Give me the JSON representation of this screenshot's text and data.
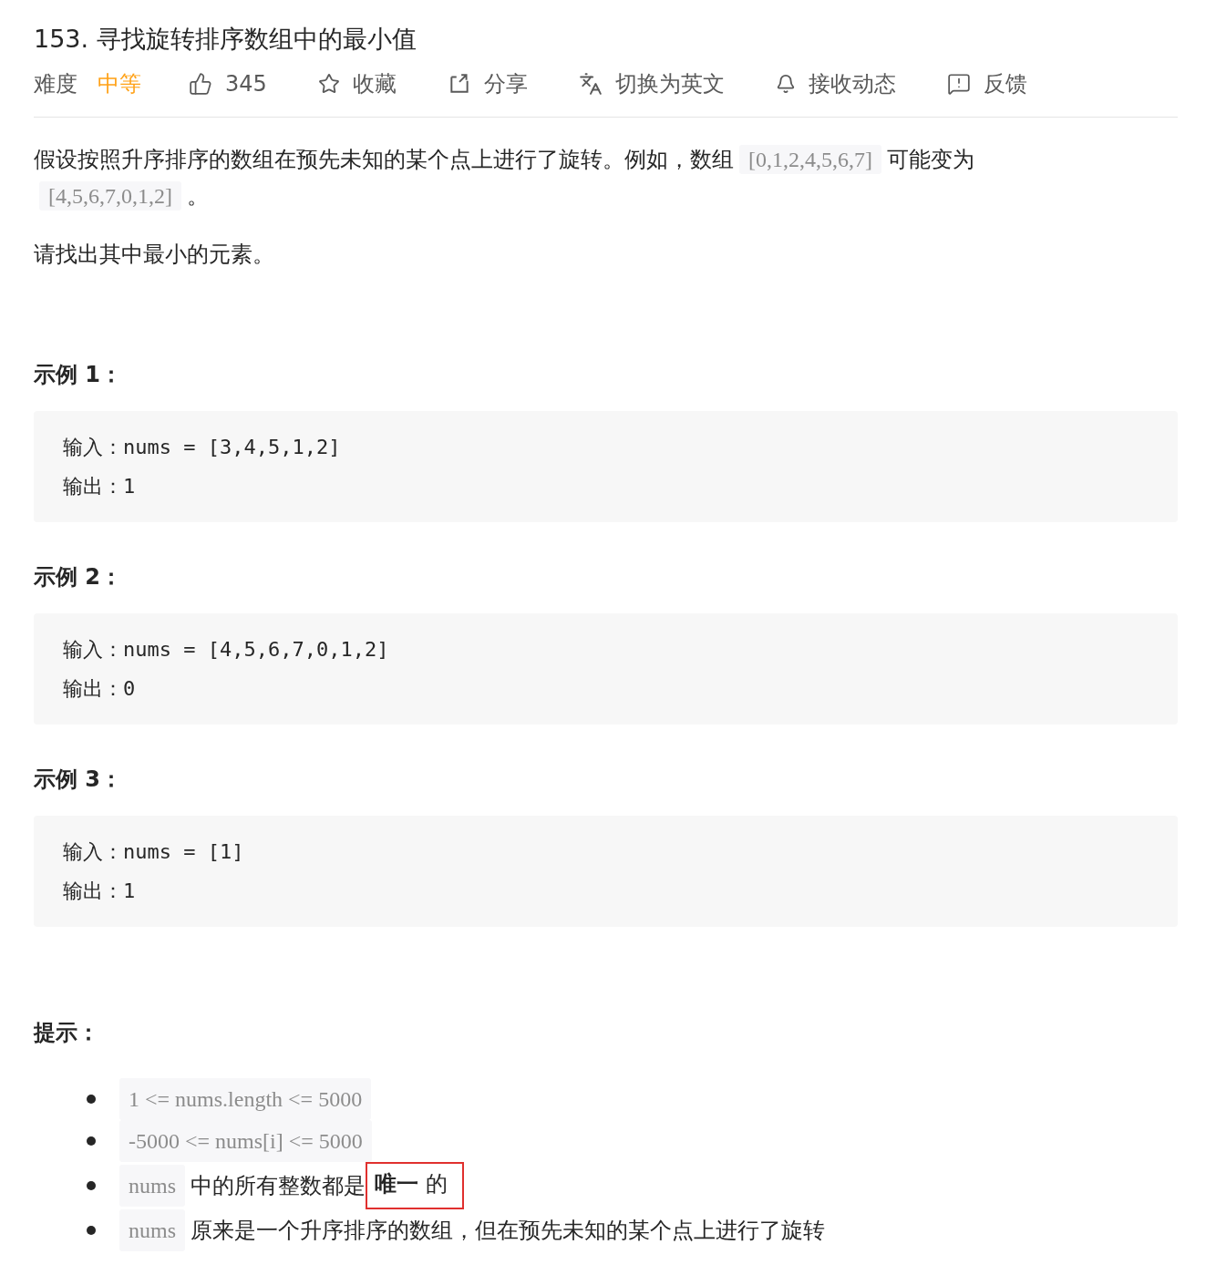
{
  "title": "153. 寻找旋转排序数组中的最小值",
  "meta": {
    "difficulty_label": "难度",
    "difficulty": "中等"
  },
  "actions": [
    {
      "kind": "like",
      "label": "345"
    },
    {
      "kind": "star",
      "label": "收藏"
    },
    {
      "kind": "share",
      "label": "分享"
    },
    {
      "kind": "translate",
      "label": "切换为英文"
    },
    {
      "kind": "bell",
      "label": "接收动态"
    },
    {
      "kind": "feedback",
      "label": "反馈"
    }
  ],
  "description": [
    [
      {
        "kind": "text",
        "text": "假设按照升序排序的数组在预先未知的某个点上进行了旋转。例如，数组"
      },
      {
        "kind": "code",
        "text": "[0,1,2,4,5,6,7]"
      },
      {
        "kind": "text",
        "text": "可能变为"
      },
      {
        "kind": "code",
        "text": "[4,5,6,7,0,1,2]"
      },
      {
        "kind": "text",
        "text": "。"
      }
    ],
    [
      {
        "kind": "text",
        "text": "请找出其中最小的元素。"
      }
    ]
  ],
  "examples": [
    {
      "heading": "示例 1：",
      "lines": [
        "输入：nums = [3,4,5,1,2]",
        "输出：1"
      ]
    },
    {
      "heading": "示例 2：",
      "lines": [
        "输入：nums = [4,5,6,7,0,1,2]",
        "输出：0"
      ]
    },
    {
      "heading": "示例 3：",
      "lines": [
        "输入：nums = [1]",
        "输出：1"
      ]
    }
  ],
  "hints": {
    "heading": "提示：",
    "items": [
      [
        {
          "kind": "code",
          "text": "1 <= nums.length <= 5000"
        }
      ],
      [
        {
          "kind": "code",
          "text": "-5000 <= nums[i] <= 5000"
        }
      ],
      [
        {
          "kind": "code",
          "text": "nums"
        },
        {
          "kind": "text",
          "text": "中的所有整数都是"
        },
        {
          "kind": "marked",
          "text": "**唯一** 的"
        }
      ],
      [
        {
          "kind": "code",
          "text": "nums"
        },
        {
          "kind": "text",
          "text": "原来是一个升序排序的数组，但在预先未知的某个点上进行了旋转"
        }
      ]
    ]
  }
}
